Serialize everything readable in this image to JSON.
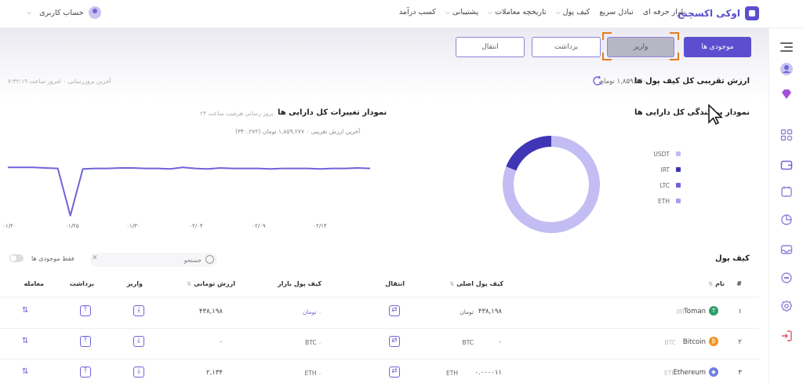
{
  "brand": {
    "name": "اوکی اکسچنج"
  },
  "nav": [
    {
      "label": "بازار حرفه ای",
      "has_menu": false
    },
    {
      "label": "تبادل سریع",
      "has_menu": false
    },
    {
      "label": "کیف پول",
      "has_menu": true
    },
    {
      "label": "تاریخچه معاملات",
      "has_menu": true
    },
    {
      "label": "پشتیبانی",
      "has_menu": true
    },
    {
      "label": "کسب درآمد",
      "has_menu": false
    }
  ],
  "user": {
    "label": "حساب کاربری"
  },
  "actions": {
    "assets": "موجودی ها",
    "deposit": "واریز",
    "withdraw": "برداشت",
    "transfer": "انتقال"
  },
  "wallet_value": {
    "title": "ارزش تقریبی کل کیف پول ها",
    "amount": "۱,۸۵۹,۱۴۰ تومان",
    "update_info": "آخرین بروزرسانی ۰ امروز ساعت ۷:۳۲:۱۹"
  },
  "donut_card": {
    "title": "نمودار پراکندگی کل دارایی ها",
    "legend": [
      {
        "label": "USDT",
        "color": "#c3bdf3"
      },
      {
        "label": "IRT",
        "color": "#3f35b5"
      },
      {
        "label": "LTC",
        "color": "#6f63d8"
      },
      {
        "label": "ETH",
        "color": "#a89ef0"
      }
    ]
  },
  "line_card": {
    "title": "نمودار تغییرات کل دارایی ها",
    "note": "بروز رسانی هرشب ساعت ۲۴",
    "subtitle": "آخرین ارزش تقریبی ۰ ۱,۸۵۹,۲۷۷ تومان (۳۴۰,۲۷۲)"
  },
  "chart_data": [
    {
      "type": "pie",
      "title": "نمودار پراکندگی کل دارایی ها",
      "categories": [
        "USDT",
        "IRT",
        "LTC",
        "ETH"
      ],
      "values": [
        81,
        19,
        0,
        0
      ],
      "colors": [
        "#c3bdf3",
        "#3f35b5",
        "#6f63d8",
        "#a89ef0"
      ]
    },
    {
      "type": "line",
      "title": "نمودار تغییرات کل دارایی ها",
      "x_ticks": [
        "۰۱/۲۰",
        "۰۱/۲۵",
        "۰۱/۳۰",
        "۰۲/۰۴",
        "۰۲/۰۹",
        "۰۲/۱۴"
      ],
      "x": [
        0,
        1,
        2,
        3,
        4,
        5,
        6,
        7,
        8,
        9,
        10,
        11,
        12,
        13,
        14,
        15,
        16,
        17,
        18,
        19,
        20,
        21,
        22,
        23,
        24,
        25,
        26,
        27,
        28,
        29
      ],
      "series": [
        {
          "values": [
            0.98,
            0.98,
            0.98,
            0.97,
            0.96,
            0.05,
            0.95,
            0.96,
            0.96,
            0.97,
            0.97,
            0.96,
            0.96,
            0.95,
            0.98,
            0.96,
            0.95,
            0.97,
            0.96,
            0.96,
            0.96,
            0.95,
            0.96,
            0.96,
            0.96,
            0.95,
            0.96,
            0.96,
            0.97,
            0.96
          ],
          "color": "#6f63d8"
        }
      ],
      "grid": false
    }
  ],
  "wallet_table": {
    "title": "کیف پول",
    "search_placeholder": "جستجو",
    "only_balance_label": "فقط موجودی ها",
    "columns": {
      "index": "#",
      "name": "نام",
      "main_wallet": "کیف پول اصلی",
      "transfer": "انتقال",
      "market_wallet": "کیف پول بازار",
      "toman_value": "ارزش تومانی",
      "deposit": "واریز",
      "withdraw": "برداشت",
      "trade": "معامله"
    },
    "rows": [
      {
        "index": "۱",
        "name": "Toman",
        "symbol": "IRT",
        "main": "۴۳۸,۱۹۸",
        "main_unit": "تومان",
        "market": "۰ تومان",
        "value": "۴۳۸,۱۹۸",
        "coin_color": "#2e9e6b",
        "coin_glyph": "T"
      },
      {
        "index": "۲",
        "name": "Bitcoin",
        "symbol": "BTC",
        "main": "۰",
        "main_unit": "BTC",
        "market": "۰ BTC",
        "value": "۰",
        "coin_color": "#f2931a",
        "coin_glyph": "₿"
      },
      {
        "index": "۳",
        "name": "Ethereum",
        "symbol": "ETH",
        "main": "۰.۰۰۰۰۱۱",
        "main_unit": "ETH",
        "market": "۰ ETH",
        "value": "۲,۱۳۴",
        "coin_color": "#6d7fe0",
        "coin_glyph": "◆"
      }
    ]
  }
}
